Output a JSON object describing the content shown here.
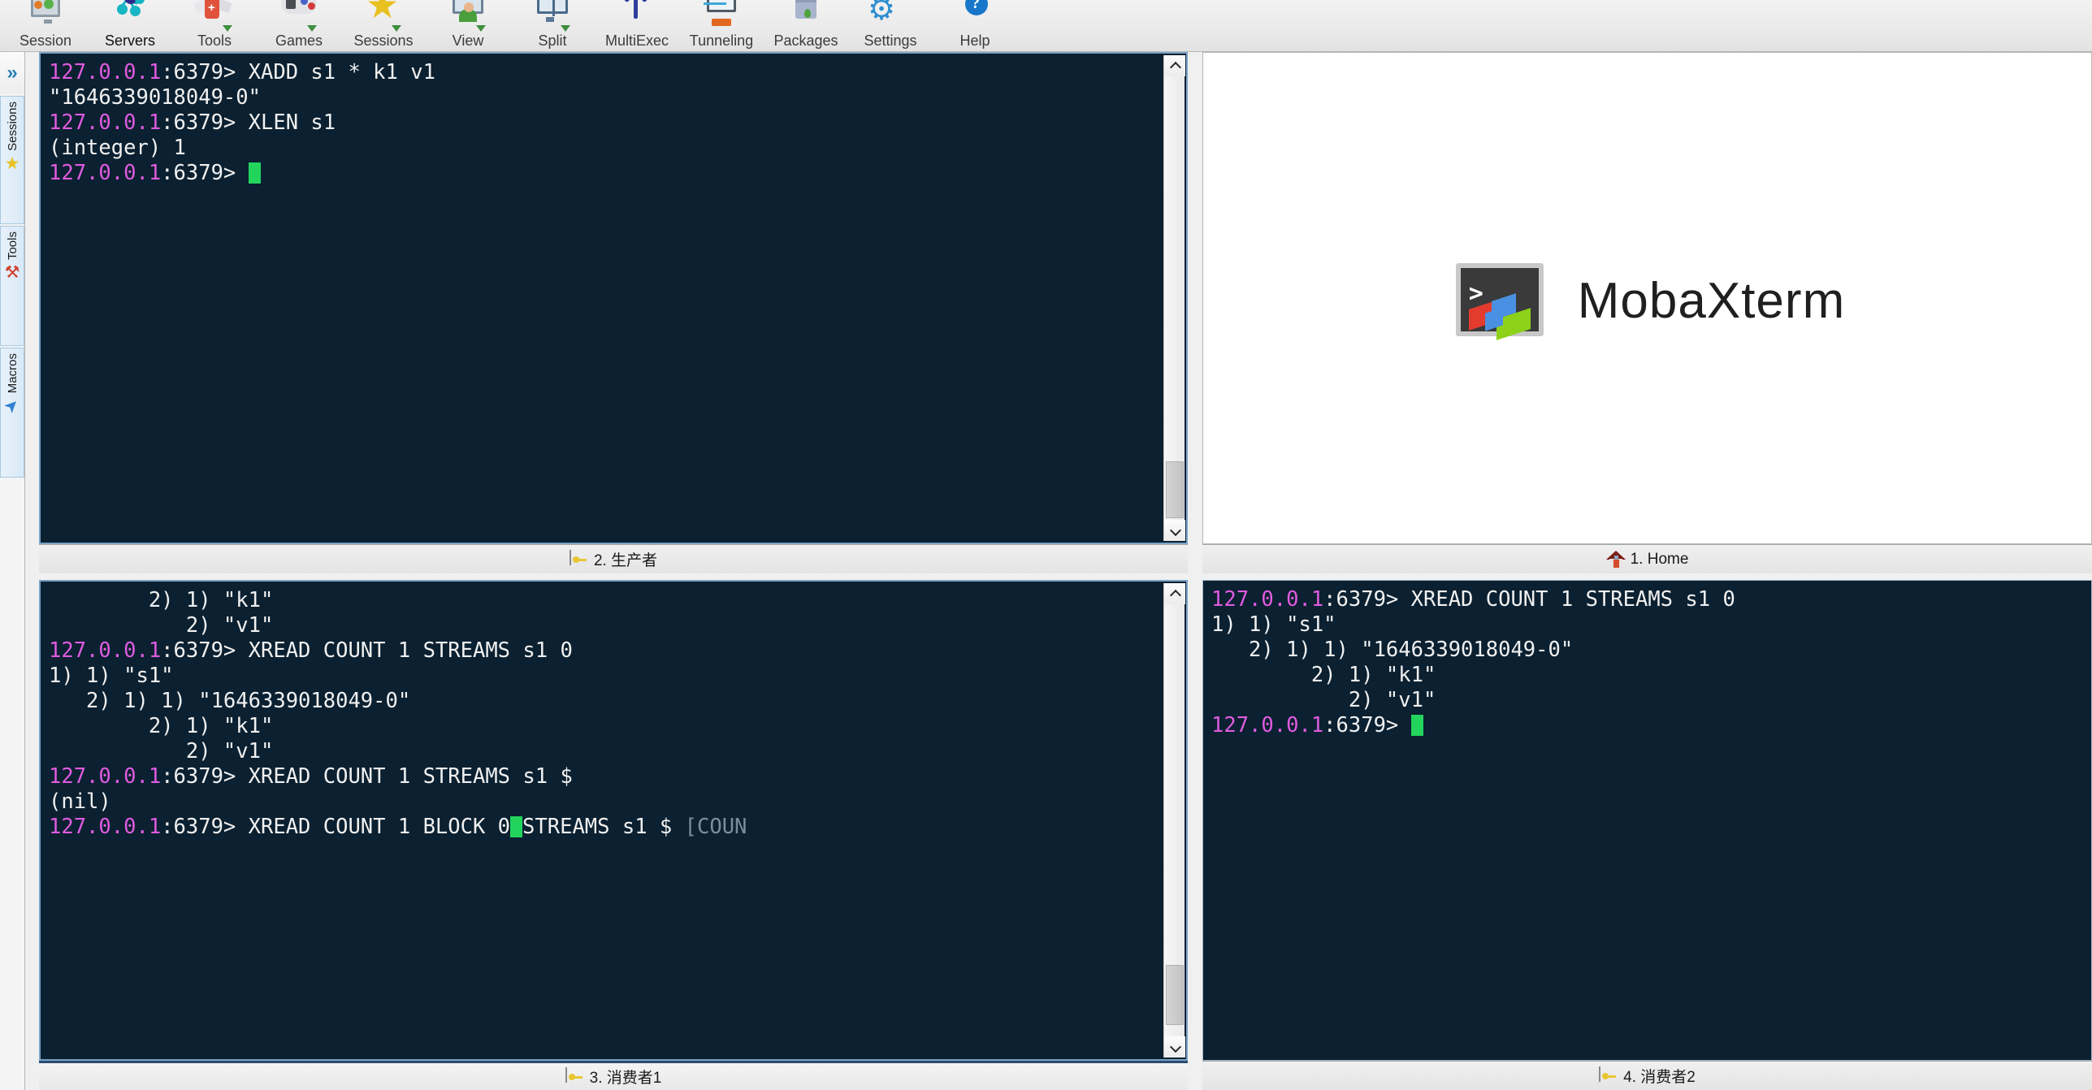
{
  "toolbar": {
    "items": [
      {
        "label": "Session",
        "icon": "monitor-icon"
      },
      {
        "label": "Servers",
        "icon": "servers-node-icon"
      },
      {
        "label": "Tools",
        "icon": "swiss-knife-icon"
      },
      {
        "label": "Games",
        "icon": "gamepad-icon"
      },
      {
        "label": "Sessions",
        "icon": "star-icon"
      },
      {
        "label": "View",
        "icon": "view-screen-icon"
      },
      {
        "label": "Split",
        "icon": "split-screen-icon"
      },
      {
        "label": "MultiExec",
        "icon": "fork-icon"
      },
      {
        "label": "Tunneling",
        "icon": "tunnel-icon"
      },
      {
        "label": "Packages",
        "icon": "package-icon"
      },
      {
        "label": "Settings",
        "icon": "gear-icon"
      },
      {
        "label": "Help",
        "icon": "help-question-icon"
      }
    ]
  },
  "sidebar": {
    "expand_glyph": "»",
    "groups": [
      {
        "label": "Sessions",
        "icon": "star-icon",
        "glyph": "★",
        "color": "#e8c020"
      },
      {
        "label": "Tools",
        "icon": "swiss-knife-icon",
        "glyph": "⚒",
        "color": "#d0402c"
      },
      {
        "label": "Macros",
        "icon": "macro-arrow-icon",
        "glyph": "➤",
        "color": "#2f7fd0"
      }
    ]
  },
  "panels": {
    "top_left": {
      "tab": {
        "number_label": "2. 生产者",
        "icon": "key-icon"
      },
      "active": true,
      "lines": [
        [
          {
            "t": "127.0.0.1",
            "c": "prompt"
          },
          {
            "t": ":6379> XADD s1 * k1 v1",
            "c": "out"
          }
        ],
        [
          {
            "t": "\"1646339018049-0\"",
            "c": "out"
          }
        ],
        [
          {
            "t": "127.0.0.1",
            "c": "prompt"
          },
          {
            "t": ":6379> XLEN s1",
            "c": "out"
          }
        ],
        [
          {
            "t": "(integer) 1",
            "c": "out"
          }
        ],
        [
          {
            "t": "127.0.0.1",
            "c": "prompt"
          },
          {
            "t": ":6379> ",
            "c": "out"
          },
          {
            "t": "",
            "c": "cursor"
          }
        ]
      ]
    },
    "top_right": {
      "tab": {
        "number_label": "1. Home",
        "icon": "home-icon"
      },
      "active": false,
      "brand": "MobaXterm",
      "logo_prompt": ">_"
    },
    "bottom_left": {
      "tab": {
        "number_label": "3. 消费者1",
        "icon": "key-icon"
      },
      "active": true,
      "lines": [
        [
          {
            "t": "        2) 1) \"k1\"",
            "c": "out"
          }
        ],
        [
          {
            "t": "           2) \"v1\"",
            "c": "out"
          }
        ],
        [
          {
            "t": "127.0.0.1",
            "c": "prompt"
          },
          {
            "t": ":6379> XREAD COUNT 1 STREAMS s1 0",
            "c": "out"
          }
        ],
        [
          {
            "t": "1) 1) \"s1\"",
            "c": "out"
          }
        ],
        [
          {
            "t": "   2) 1) 1) \"1646339018049-0\"",
            "c": "out"
          }
        ],
        [
          {
            "t": "        2) 1) \"k1\"",
            "c": "out"
          }
        ],
        [
          {
            "t": "           2) \"v1\"",
            "c": "out"
          }
        ],
        [
          {
            "t": "127.0.0.1",
            "c": "prompt"
          },
          {
            "t": ":6379> XREAD COUNT 1 STREAMS s1 $",
            "c": "out"
          }
        ],
        [
          {
            "t": "(nil)",
            "c": "out"
          }
        ],
        [
          {
            "t": "127.0.0.1",
            "c": "prompt"
          },
          {
            "t": ":6379> XREAD COUNT 1 BLOCK 0",
            "c": "out"
          },
          {
            "t": "",
            "c": "cursor"
          },
          {
            "t": "STREAMS s1 $ ",
            "c": "out"
          },
          {
            "t": "[COUN",
            "c": "hint"
          }
        ]
      ]
    },
    "bottom_right": {
      "tab": {
        "number_label": "4. 消费者2",
        "icon": "key-icon"
      },
      "active": false,
      "lines": [
        [
          {
            "t": "127.0.0.1",
            "c": "prompt"
          },
          {
            "t": ":6379> XREAD COUNT 1 STREAMS s1 0",
            "c": "out"
          }
        ],
        [
          {
            "t": "1) 1) \"s1\"",
            "c": "out"
          }
        ],
        [
          {
            "t": "   2) 1) 1) \"1646339018049-0\"",
            "c": "out"
          }
        ],
        [
          {
            "t": "        2) 1) \"k1\"",
            "c": "out"
          }
        ],
        [
          {
            "t": "           2) \"v1\"",
            "c": "out"
          }
        ],
        [
          {
            "t": "127.0.0.1",
            "c": "prompt"
          },
          {
            "t": ":6379> ",
            "c": "out"
          },
          {
            "t": "",
            "c": "cursor"
          }
        ]
      ]
    }
  },
  "colors": {
    "terminal_bg": "#0b2030",
    "prompt_magenta": "#e05be0",
    "text_white": "#f0f0f0",
    "cursor_green": "#22d45c",
    "hint_grey": "#7d8da0",
    "panel_border_active": "#7aa3c8",
    "toolbar_bg": "#eaeaea"
  }
}
